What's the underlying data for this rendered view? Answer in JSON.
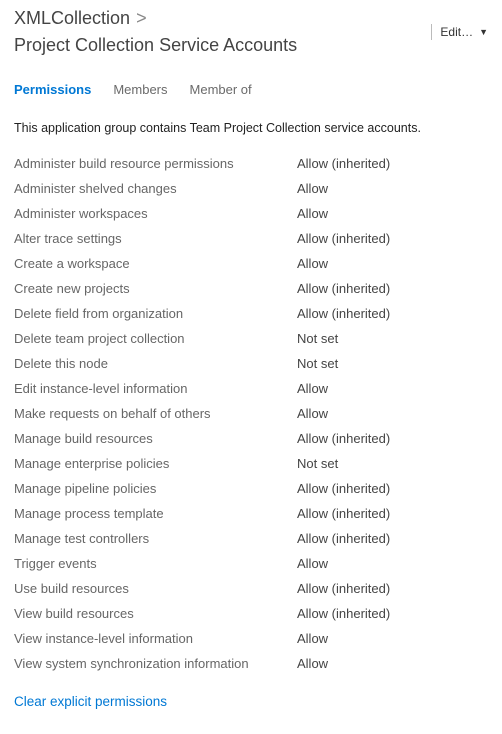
{
  "breadcrumb": {
    "root": "XMLCollection",
    "sep": ">",
    "current": "Project Collection Service Accounts"
  },
  "header": {
    "edit_label": "Edit…"
  },
  "tabs": [
    {
      "label": "Permissions",
      "active": true
    },
    {
      "label": "Members",
      "active": false
    },
    {
      "label": "Member of",
      "active": false
    }
  ],
  "description": "This application group contains Team Project Collection service accounts.",
  "permissions": [
    {
      "name": "Administer build resource permissions",
      "value": "Allow (inherited)"
    },
    {
      "name": "Administer shelved changes",
      "value": "Allow"
    },
    {
      "name": "Administer workspaces",
      "value": "Allow"
    },
    {
      "name": "Alter trace settings",
      "value": "Allow (inherited)"
    },
    {
      "name": "Create a workspace",
      "value": "Allow"
    },
    {
      "name": "Create new projects",
      "value": "Allow (inherited)"
    },
    {
      "name": "Delete field from organization",
      "value": "Allow (inherited)"
    },
    {
      "name": "Delete team project collection",
      "value": "Not set"
    },
    {
      "name": "Delete this node",
      "value": "Not set"
    },
    {
      "name": "Edit instance-level information",
      "value": "Allow"
    },
    {
      "name": "Make requests on behalf of others",
      "value": "Allow"
    },
    {
      "name": "Manage build resources",
      "value": "Allow (inherited)"
    },
    {
      "name": "Manage enterprise policies",
      "value": "Not set"
    },
    {
      "name": "Manage pipeline policies",
      "value": "Allow (inherited)"
    },
    {
      "name": "Manage process template",
      "value": "Allow (inherited)"
    },
    {
      "name": "Manage test controllers",
      "value": "Allow (inherited)"
    },
    {
      "name": "Trigger events",
      "value": "Allow"
    },
    {
      "name": "Use build resources",
      "value": "Allow (inherited)"
    },
    {
      "name": "View build resources",
      "value": "Allow (inherited)"
    },
    {
      "name": "View instance-level information",
      "value": "Allow"
    },
    {
      "name": "View system synchronization information",
      "value": "Allow"
    }
  ],
  "actions": {
    "clear_permissions": "Clear explicit permissions"
  }
}
